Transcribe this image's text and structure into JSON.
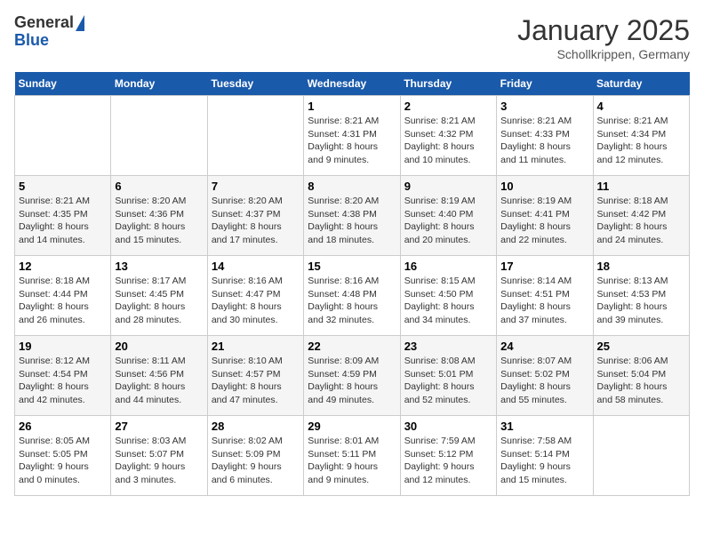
{
  "logo": {
    "general": "General",
    "blue": "Blue"
  },
  "title": "January 2025",
  "subtitle": "Schollkrippen, Germany",
  "days_header": [
    "Sunday",
    "Monday",
    "Tuesday",
    "Wednesday",
    "Thursday",
    "Friday",
    "Saturday"
  ],
  "weeks": [
    [
      {
        "day": "",
        "info": ""
      },
      {
        "day": "",
        "info": ""
      },
      {
        "day": "",
        "info": ""
      },
      {
        "day": "1",
        "info": "Sunrise: 8:21 AM\nSunset: 4:31 PM\nDaylight: 8 hours\nand 9 minutes."
      },
      {
        "day": "2",
        "info": "Sunrise: 8:21 AM\nSunset: 4:32 PM\nDaylight: 8 hours\nand 10 minutes."
      },
      {
        "day": "3",
        "info": "Sunrise: 8:21 AM\nSunset: 4:33 PM\nDaylight: 8 hours\nand 11 minutes."
      },
      {
        "day": "4",
        "info": "Sunrise: 8:21 AM\nSunset: 4:34 PM\nDaylight: 8 hours\nand 12 minutes."
      }
    ],
    [
      {
        "day": "5",
        "info": "Sunrise: 8:21 AM\nSunset: 4:35 PM\nDaylight: 8 hours\nand 14 minutes."
      },
      {
        "day": "6",
        "info": "Sunrise: 8:20 AM\nSunset: 4:36 PM\nDaylight: 8 hours\nand 15 minutes."
      },
      {
        "day": "7",
        "info": "Sunrise: 8:20 AM\nSunset: 4:37 PM\nDaylight: 8 hours\nand 17 minutes."
      },
      {
        "day": "8",
        "info": "Sunrise: 8:20 AM\nSunset: 4:38 PM\nDaylight: 8 hours\nand 18 minutes."
      },
      {
        "day": "9",
        "info": "Sunrise: 8:19 AM\nSunset: 4:40 PM\nDaylight: 8 hours\nand 20 minutes."
      },
      {
        "day": "10",
        "info": "Sunrise: 8:19 AM\nSunset: 4:41 PM\nDaylight: 8 hours\nand 22 minutes."
      },
      {
        "day": "11",
        "info": "Sunrise: 8:18 AM\nSunset: 4:42 PM\nDaylight: 8 hours\nand 24 minutes."
      }
    ],
    [
      {
        "day": "12",
        "info": "Sunrise: 8:18 AM\nSunset: 4:44 PM\nDaylight: 8 hours\nand 26 minutes."
      },
      {
        "day": "13",
        "info": "Sunrise: 8:17 AM\nSunset: 4:45 PM\nDaylight: 8 hours\nand 28 minutes."
      },
      {
        "day": "14",
        "info": "Sunrise: 8:16 AM\nSunset: 4:47 PM\nDaylight: 8 hours\nand 30 minutes."
      },
      {
        "day": "15",
        "info": "Sunrise: 8:16 AM\nSunset: 4:48 PM\nDaylight: 8 hours\nand 32 minutes."
      },
      {
        "day": "16",
        "info": "Sunrise: 8:15 AM\nSunset: 4:50 PM\nDaylight: 8 hours\nand 34 minutes."
      },
      {
        "day": "17",
        "info": "Sunrise: 8:14 AM\nSunset: 4:51 PM\nDaylight: 8 hours\nand 37 minutes."
      },
      {
        "day": "18",
        "info": "Sunrise: 8:13 AM\nSunset: 4:53 PM\nDaylight: 8 hours\nand 39 minutes."
      }
    ],
    [
      {
        "day": "19",
        "info": "Sunrise: 8:12 AM\nSunset: 4:54 PM\nDaylight: 8 hours\nand 42 minutes."
      },
      {
        "day": "20",
        "info": "Sunrise: 8:11 AM\nSunset: 4:56 PM\nDaylight: 8 hours\nand 44 minutes."
      },
      {
        "day": "21",
        "info": "Sunrise: 8:10 AM\nSunset: 4:57 PM\nDaylight: 8 hours\nand 47 minutes."
      },
      {
        "day": "22",
        "info": "Sunrise: 8:09 AM\nSunset: 4:59 PM\nDaylight: 8 hours\nand 49 minutes."
      },
      {
        "day": "23",
        "info": "Sunrise: 8:08 AM\nSunset: 5:01 PM\nDaylight: 8 hours\nand 52 minutes."
      },
      {
        "day": "24",
        "info": "Sunrise: 8:07 AM\nSunset: 5:02 PM\nDaylight: 8 hours\nand 55 minutes."
      },
      {
        "day": "25",
        "info": "Sunrise: 8:06 AM\nSunset: 5:04 PM\nDaylight: 8 hours\nand 58 minutes."
      }
    ],
    [
      {
        "day": "26",
        "info": "Sunrise: 8:05 AM\nSunset: 5:05 PM\nDaylight: 9 hours\nand 0 minutes."
      },
      {
        "day": "27",
        "info": "Sunrise: 8:03 AM\nSunset: 5:07 PM\nDaylight: 9 hours\nand 3 minutes."
      },
      {
        "day": "28",
        "info": "Sunrise: 8:02 AM\nSunset: 5:09 PM\nDaylight: 9 hours\nand 6 minutes."
      },
      {
        "day": "29",
        "info": "Sunrise: 8:01 AM\nSunset: 5:11 PM\nDaylight: 9 hours\nand 9 minutes."
      },
      {
        "day": "30",
        "info": "Sunrise: 7:59 AM\nSunset: 5:12 PM\nDaylight: 9 hours\nand 12 minutes."
      },
      {
        "day": "31",
        "info": "Sunrise: 7:58 AM\nSunset: 5:14 PM\nDaylight: 9 hours\nand 15 minutes."
      },
      {
        "day": "",
        "info": ""
      }
    ]
  ]
}
